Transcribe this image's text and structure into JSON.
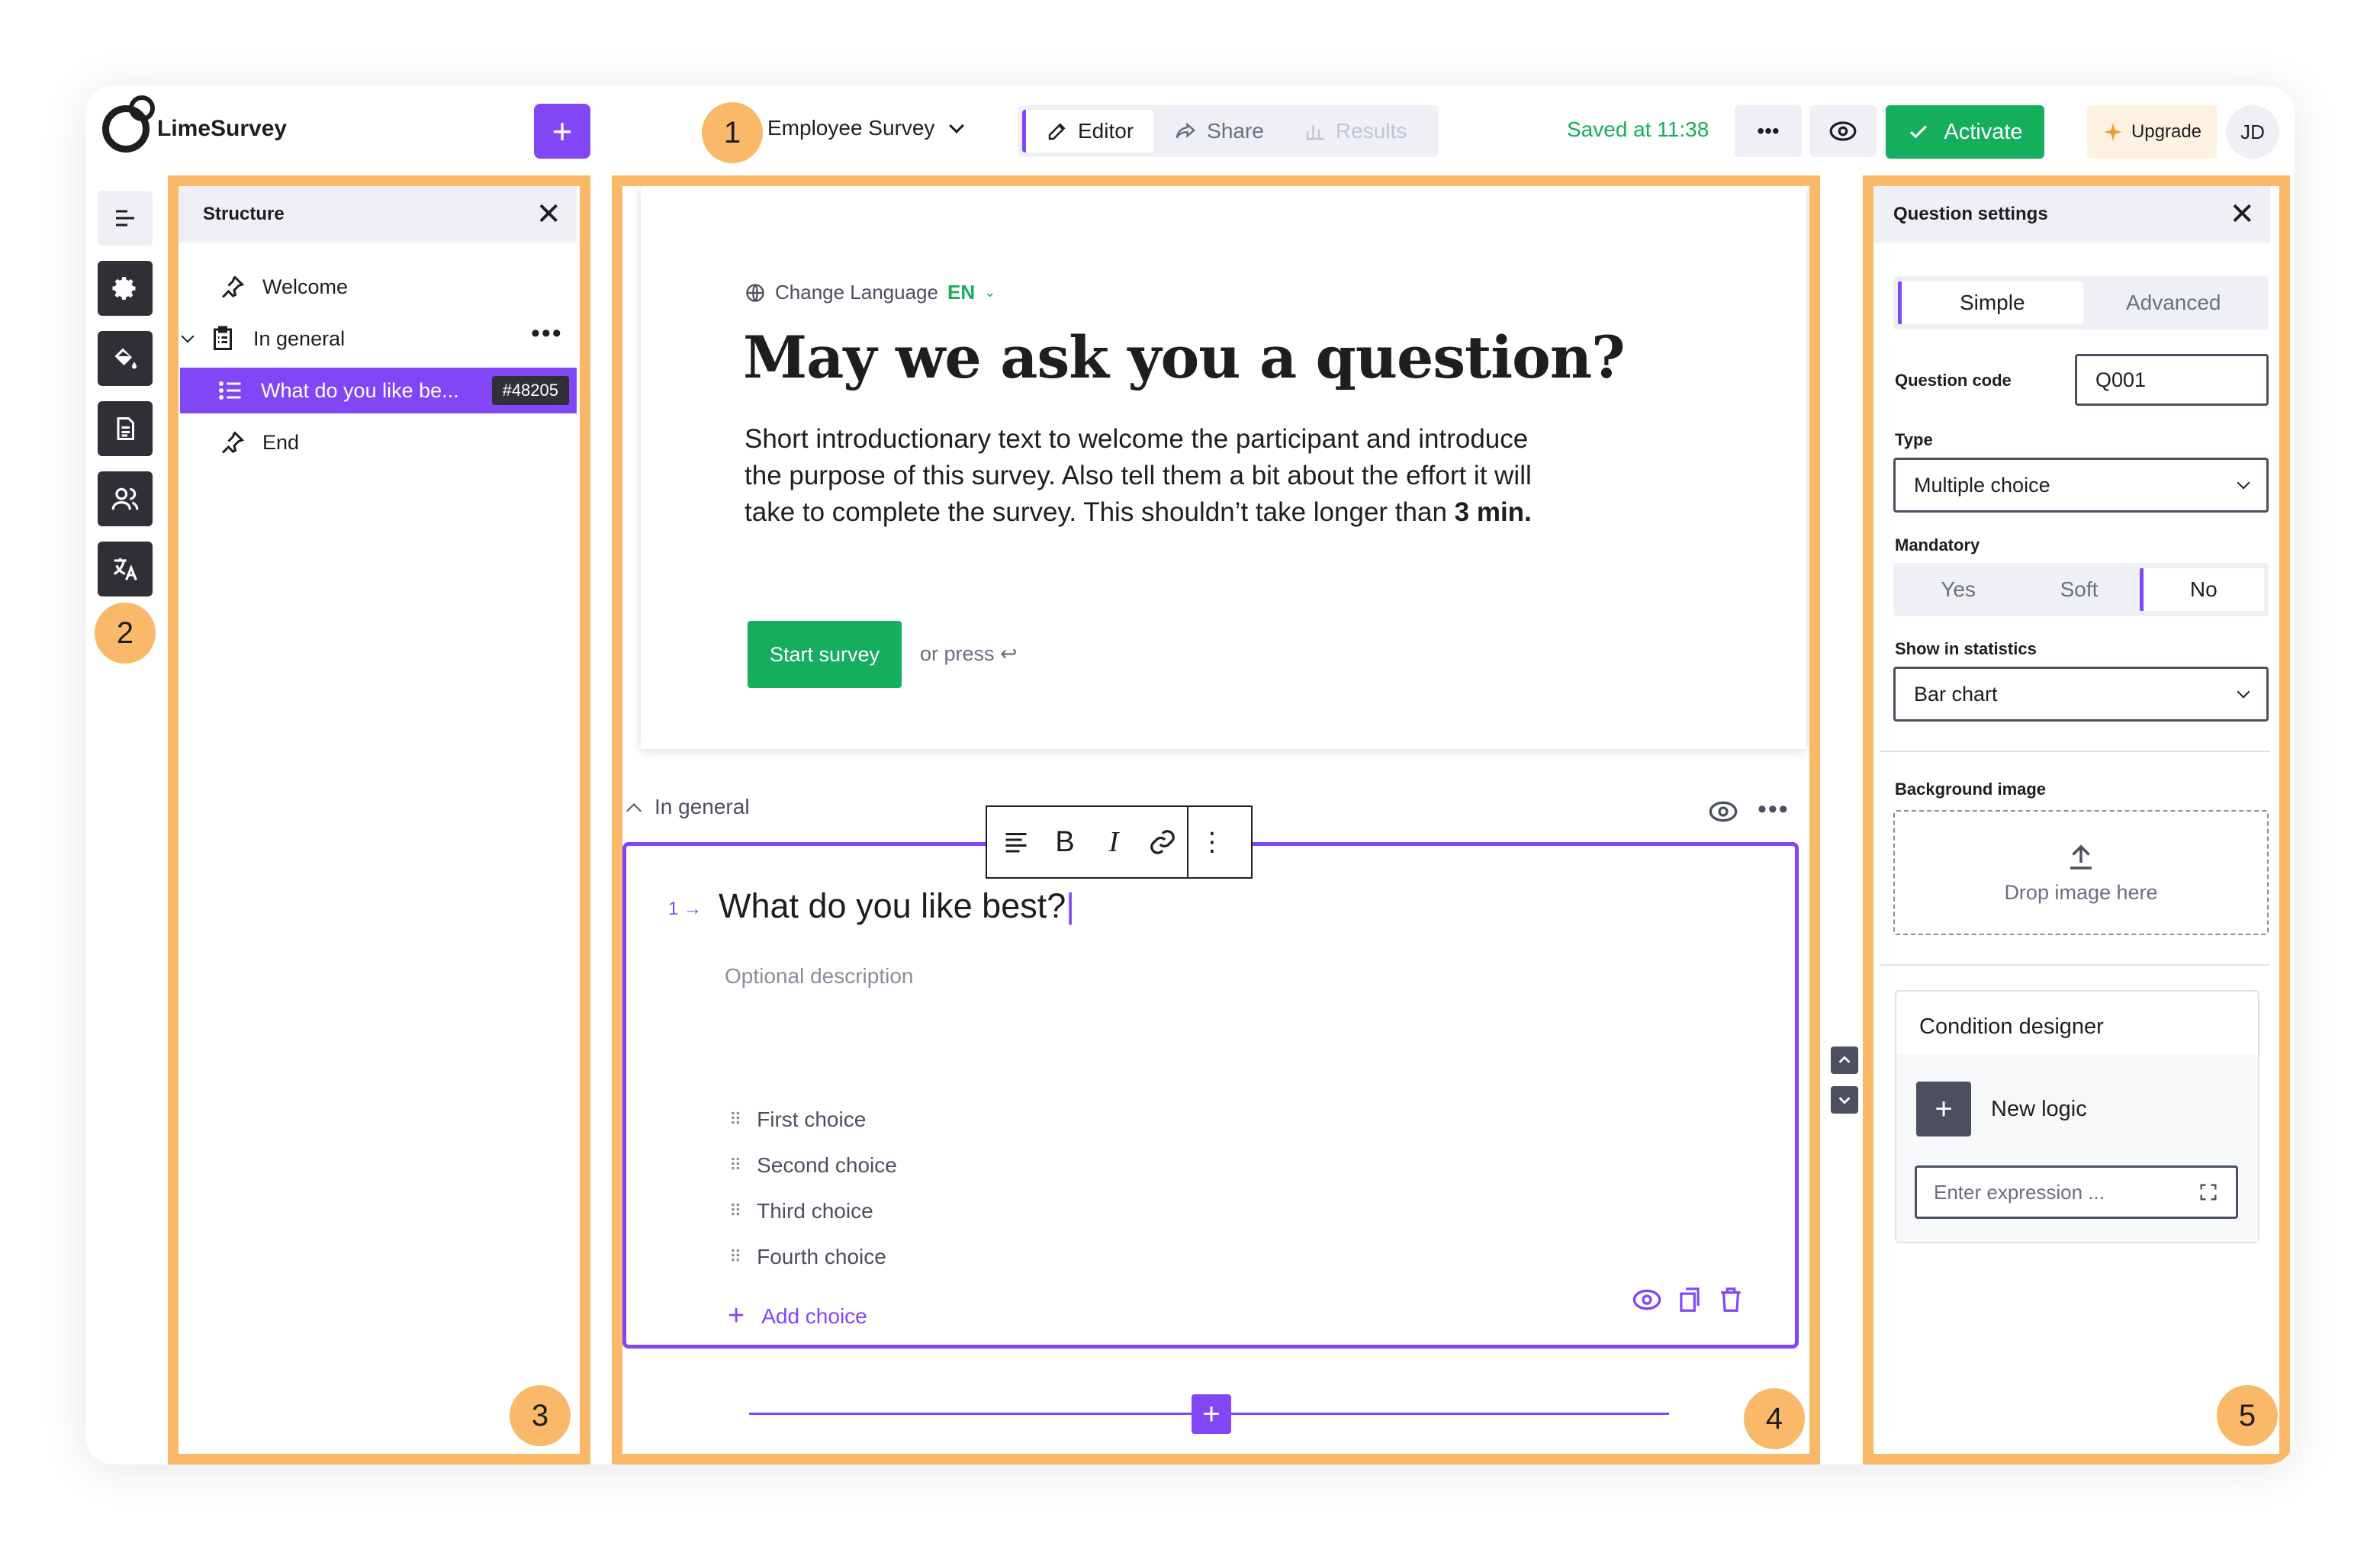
{
  "header": {
    "logo_text": "LimeSurvey",
    "survey_title": "Employee Survey",
    "modes": [
      {
        "label": "Editor",
        "icon": "pencil-icon",
        "state": "active"
      },
      {
        "label": "Share",
        "icon": "share-icon",
        "state": "normal"
      },
      {
        "label": "Results",
        "icon": "bar-chart-icon",
        "state": "disabled"
      }
    ],
    "saved_text": "Saved at 11:38",
    "more_label": "•••",
    "activate_label": "Activate",
    "upgrade_label": "Upgrade",
    "avatar_initials": "JD"
  },
  "annotations": [
    "1",
    "2",
    "3",
    "4",
    "5"
  ],
  "structure": {
    "title": "Structure",
    "items": [
      {
        "label": "Welcome"
      },
      {
        "label": "In general"
      },
      {
        "label": "What do you like be...",
        "badge": "#48205"
      },
      {
        "label": "End"
      }
    ]
  },
  "editor": {
    "language_label": "Change Language",
    "language_code": "EN",
    "headline": "May we ask you a question?",
    "intro_text": "Short introductionary text to welcome the participant and introduce the purpose of this survey. Also tell them a bit about the effort it will take to complete the survey. This shouldn’t take longer than ",
    "intro_bold": "3 min.",
    "start_button": "Start survey",
    "press_hint": "or press ↩",
    "group_title": "In general",
    "question_number": "1 →",
    "question_title": "What do you like best?",
    "question_description": "Optional description",
    "choices": [
      "First choice",
      "Second choice",
      "Third choice",
      "Fourth choice"
    ],
    "add_choice": "Add choice"
  },
  "settings": {
    "title": "Question settings",
    "tabs": [
      "Simple",
      "Advanced"
    ],
    "question_code_label": "Question code",
    "question_code": "Q001",
    "type_label": "Type",
    "type_value": "Multiple choice",
    "mandatory_label": "Mandatory",
    "mandatory_options": [
      "Yes",
      "Soft",
      "No"
    ],
    "mandatory_selected": "No",
    "statistics_label": "Show in statistics",
    "statistics_value": "Bar chart",
    "background_label": "Background image",
    "drop_text": "Drop image here",
    "condition_title": "Condition designer",
    "new_logic": "New logic",
    "expression_placeholder": "Enter expression ..."
  },
  "colors": {
    "accent": "#8146f6",
    "success": "#14ae5c",
    "annotation": "#f9b969"
  }
}
